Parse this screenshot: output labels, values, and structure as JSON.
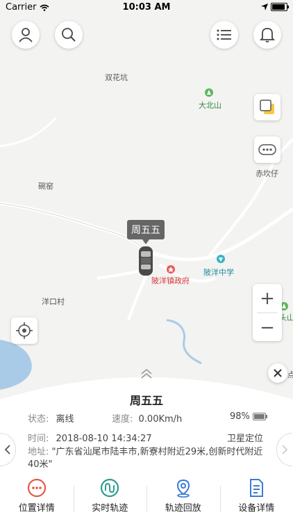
{
  "status_bar": {
    "carrier": "Carrier",
    "time": "10:03 AM"
  },
  "map": {
    "places": {
      "shuanghuakeng": "双花坑",
      "dabeishan": "大北山",
      "chikanzi": "赤坎仔",
      "wanyao": "碗窑",
      "yangkoucun": "洋口村",
      "lingyangzhen": "陂洋镇政府",
      "lingyangzhongxue": "陂洋中学",
      "toushan": "头山",
      "dian": "点"
    },
    "vehicle_label": "周五五"
  },
  "panel": {
    "vehicle_name": "周五五",
    "status_label": "状态:",
    "status_value": "离线",
    "speed_label": "速度:",
    "speed_value": "0.00Km/h",
    "battery_value": "98%",
    "battery_level": 0.98,
    "time_label": "时间:",
    "time_value": "2018-08-10 14:34:27",
    "positioning": "卫星定位",
    "address_label": "地址:",
    "address_value": "\"广东省汕尾市陆丰市,新寮村附近29米,创新时代附近40米\""
  },
  "actions": [
    {
      "label": "位置详情",
      "icon": "more-circle-icon",
      "color": "#e05a4a"
    },
    {
      "label": "实时轨迹",
      "icon": "track-icon",
      "color": "#2a9d8f"
    },
    {
      "label": "轨迹回放",
      "icon": "location-pin-icon",
      "color": "#3a7bd5"
    },
    {
      "label": "设备详情",
      "icon": "document-icon",
      "color": "#3a7bd5"
    }
  ],
  "zoom": {
    "in": "+",
    "out": "−"
  }
}
